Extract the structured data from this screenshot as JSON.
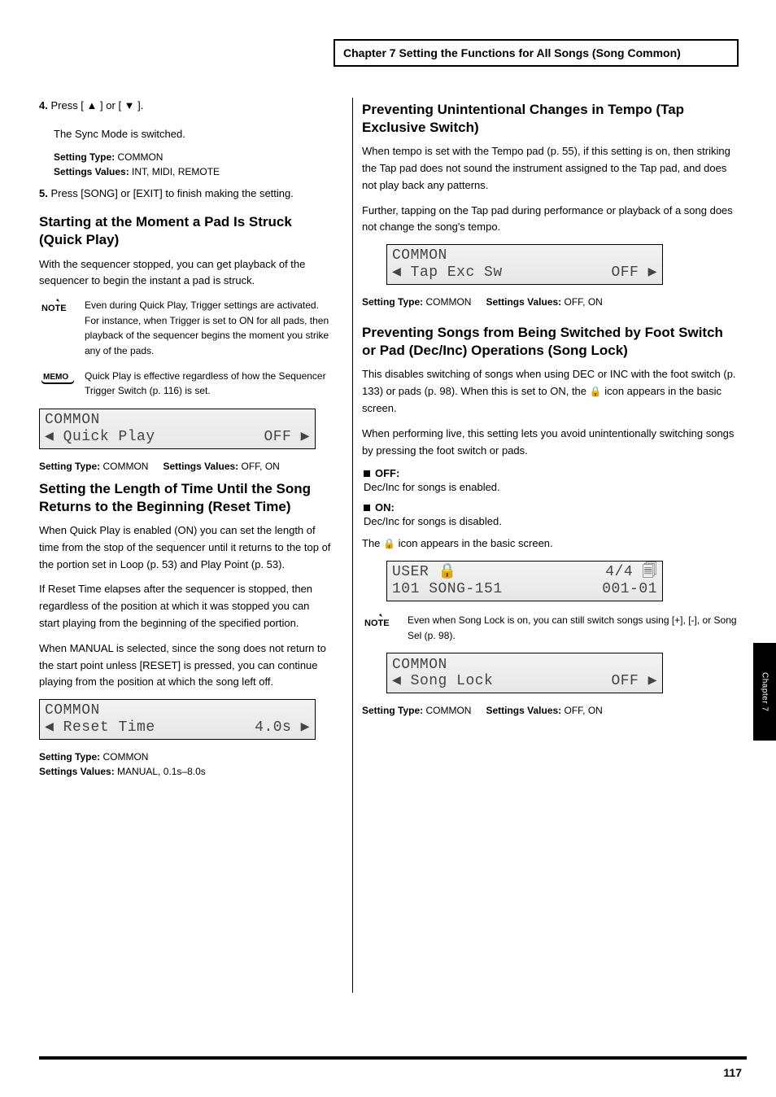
{
  "chapter_title": "Chapter 7 Setting the Functions for All Songs (Song Common)",
  "side_tab": "Chapter 7",
  "page_number": "117",
  "left": {
    "step4": {
      "num": "4.",
      "text_a": "Press [ ",
      "text_b": " ] or [ ",
      "text_c": " ]."
    },
    "step4_after": "The Sync Mode is switched.",
    "table_type": "Setting Type:",
    "table_type_val": "COMMON",
    "table_values": "Settings Values:",
    "table_values_val": "INT, MIDI, REMOTE",
    "step5": {
      "num": "5.",
      "text": "Press [SONG] or [EXIT] to finish making the setting."
    },
    "heading_quick": "Starting at the Moment a Pad Is Struck (Quick Play)",
    "quick_para": "With the sequencer stopped, you can get playback of the sequencer to begin the instant a pad is struck.",
    "note_quick": "Even during Quick Play, Trigger settings are activated. For instance, when Trigger is set to ON for all pads, then playback of the sequencer begins the moment you strike any of the pads.",
    "memo_quick": "Quick Play is effective regardless of how the Sequencer Trigger Switch (p. 116) is set.",
    "lcd_quick": {
      "line1": "COMMON",
      "line2_l": "◀ Quick Play",
      "line2_r": "  OFF ▶"
    },
    "quick_type": "Setting Type:",
    "quick_type_val": "COMMON",
    "quick_vals": "Settings Values:",
    "quick_vals_val": "OFF, ON",
    "heading_reset": "Setting the Length of Time Until the Song Returns to the Beginning (Reset Time)",
    "reset_para": "When Quick Play is enabled (ON) you can set the length of time from the stop of the sequencer until it returns to the top of the portion set in Loop (p. 53) and Play Point (p. 53).",
    "reset_item1": "If Reset Time elapses after the sequencer is stopped, then regardless of the position at which it was stopped you can start playing from the beginning of the specified portion.",
    "reset_item2": "When MANUAL is selected, since the song does not return to the start point unless [RESET] is pressed, you can continue playing from the position at which the song left off.",
    "lcd_reset": {
      "line1": "COMMON",
      "line2_l": "◀ Reset Time",
      "line2_r": " 4.0s ▶"
    },
    "reset_type": "Setting Type:",
    "reset_type_val": "COMMON",
    "reset_vals": "Settings Values:",
    "reset_vals_val": "MANUAL, 0.1s–8.0s"
  },
  "right": {
    "heading_tap": "Preventing Unintentional Changes in Tempo (Tap Exclusive Switch)",
    "tap_para1": "When tempo is set with the Tempo pad (p. 55), if this setting is on, then striking the Tap pad does not sound the instrument assigned to the Tap pad, and does not play back any patterns.",
    "tap_para2": "Further, tapping on the Tap pad during performance or playback of a song does not change the song's tempo.",
    "lcd_tap": {
      "line1": "COMMON",
      "line2_l": "◀ Tap Exc Sw",
      "line2_r": "  OFF ▶"
    },
    "tap_type": "Setting Type:",
    "tap_type_val": "COMMON",
    "tap_vals": "Settings Values:",
    "tap_vals_val": "OFF, ON",
    "heading_lock": "Preventing Songs from Being Switched by Foot Switch or Pad (Dec/Inc) Operations (Song Lock)",
    "lock_para1_a": "This disables switching of songs when using DEC or INC with the foot switch (p. 133) or pads (p. 98). When this is set to ON, the ",
    "lock_para1_b": " icon appears in the basic screen.",
    "lock_para2": "When performing live, this setting lets you avoid unintentionally switching songs by pressing the foot switch or pads.",
    "lock_bullets": [
      {
        "head": "OFF:",
        "body": "Dec/Inc for songs is enabled."
      },
      {
        "head": "ON:",
        "body": "Dec/Inc for songs is disabled."
      }
    ],
    "lock_icon_sentence_a": "The ",
    "lock_icon_sentence_b": " icon appears in the basic screen.",
    "lcd_user": {
      "line1_l": "USER 🔒",
      "line1_r": "4/4 🗐",
      "line2_l": "101 SONG-151",
      "line2_r": "001-01"
    },
    "memo_lock": "Even when Song Lock is on, you can still switch songs using [+], [-], or Song Sel (p. 98).",
    "lcd_lock": {
      "line1": "COMMON",
      "line2_l": "◀ Song Lock",
      "line2_r": "  OFF ▶"
    },
    "lock_type": "Setting Type:",
    "lock_type_val": "COMMON",
    "lock_vals": "Settings Values:",
    "lock_vals_val": "OFF, ON"
  }
}
